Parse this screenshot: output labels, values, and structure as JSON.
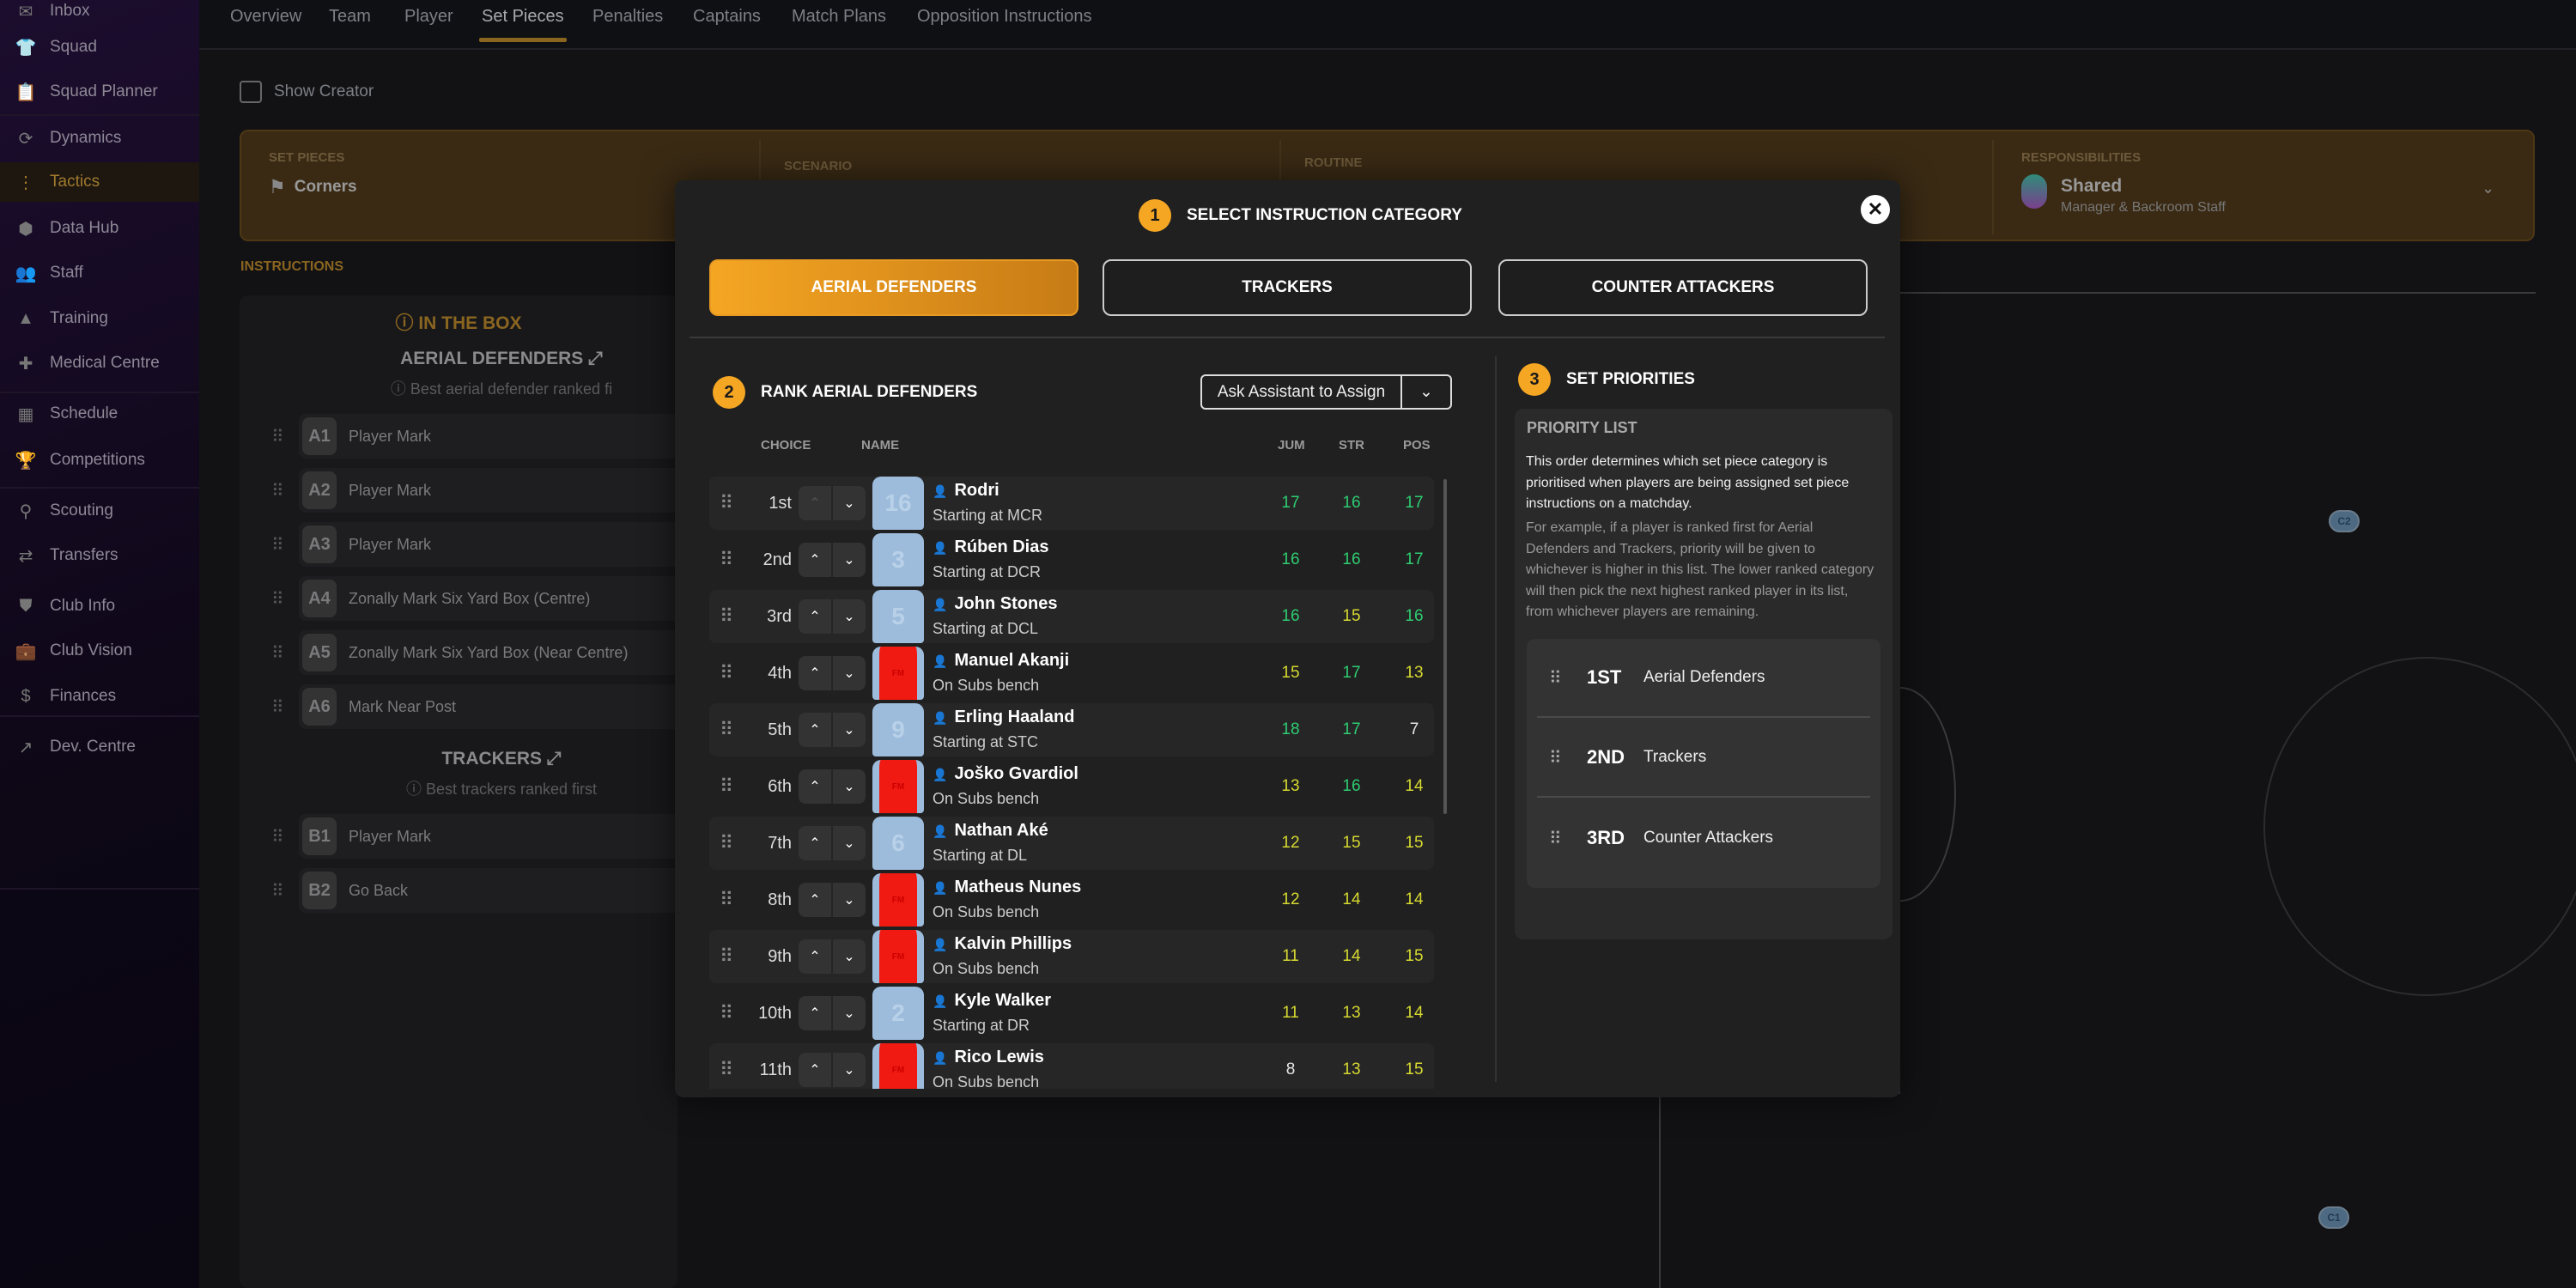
{
  "sidebar": {
    "items": [
      {
        "label": "Inbox",
        "icon": "inbox-icon",
        "glyph": "✉"
      },
      {
        "label": "Squad",
        "icon": "shirt-icon",
        "glyph": "👕"
      },
      {
        "label": "Squad Planner",
        "icon": "clipboard-icon",
        "glyph": "📋"
      },
      {
        "label": "Dynamics",
        "icon": "dynamics-icon",
        "glyph": "⟳"
      },
      {
        "label": "Tactics",
        "icon": "tactics-icon",
        "glyph": "⋮",
        "active": true
      },
      {
        "label": "Data Hub",
        "icon": "data-hub-icon",
        "glyph": "⬢"
      },
      {
        "label": "Staff",
        "icon": "staff-icon",
        "glyph": "👥"
      },
      {
        "label": "Training",
        "icon": "training-cone-icon",
        "glyph": "▲"
      },
      {
        "label": "Medical Centre",
        "icon": "medical-kit-icon",
        "glyph": "✚"
      },
      {
        "label": "Schedule",
        "icon": "calendar-icon",
        "glyph": "▦"
      },
      {
        "label": "Competitions",
        "icon": "trophy-icon",
        "glyph": "🏆"
      },
      {
        "label": "Scouting",
        "icon": "search-icon",
        "glyph": "⚲"
      },
      {
        "label": "Transfers",
        "icon": "transfers-icon",
        "glyph": "⇄"
      },
      {
        "label": "Club Info",
        "icon": "shield-icon",
        "glyph": "⛊"
      },
      {
        "label": "Club Vision",
        "icon": "briefcase-icon",
        "glyph": "💼"
      },
      {
        "label": "Finances",
        "icon": "money-icon",
        "glyph": "$"
      },
      {
        "label": "Dev. Centre",
        "icon": "growth-icon",
        "glyph": "↗"
      }
    ]
  },
  "tabs": [
    "Overview",
    "Team",
    "Player",
    "Set Pieces",
    "Penalties",
    "Captains",
    "Match Plans",
    "Opposition Instructions"
  ],
  "active_tab": "Set Pieces",
  "show_creator": {
    "label": "Show Creator",
    "checked": false
  },
  "set_pieces_band": {
    "set_pieces_label": "SET PIECES",
    "set_pieces_value": "Corners",
    "scenario_label": "SCENARIO",
    "routine_label": "ROUTINE",
    "responsibilities_label": "RESPONSIBILITIES",
    "responsibilities_value": "Shared",
    "responsibilities_sub": "Manager & Backroom Staff"
  },
  "instructions": {
    "label": "INSTRUCTIONS",
    "section": "IN THE BOX",
    "groups": [
      {
        "title": "AERIAL DEFENDERS",
        "hint": "Best aerial defender ranked fi",
        "items": [
          {
            "code": "A1",
            "text": "Player Mark"
          },
          {
            "code": "A2",
            "text": "Player Mark"
          },
          {
            "code": "A3",
            "text": "Player Mark"
          },
          {
            "code": "A4",
            "text": "Zonally Mark Six Yard Box (Centre)"
          },
          {
            "code": "A5",
            "text": "Zonally Mark Six Yard Box (Near Centre)"
          },
          {
            "code": "A6",
            "text": "Mark Near Post"
          }
        ]
      },
      {
        "title": "TRACKERS",
        "hint": "Best trackers ranked first",
        "items": [
          {
            "code": "B1",
            "text": "Player Mark"
          },
          {
            "code": "B2",
            "text": "Go Back"
          }
        ]
      }
    ]
  },
  "pitch": {
    "markers": [
      "C2",
      "C1"
    ]
  },
  "modal": {
    "step1": {
      "num": "1",
      "title": "SELECT INSTRUCTION CATEGORY"
    },
    "categories": [
      "AERIAL DEFENDERS",
      "TRACKERS",
      "COUNTER ATTACKERS"
    ],
    "active_category": "AERIAL DEFENDERS",
    "step2": {
      "num": "2",
      "title": "RANK AERIAL DEFENDERS"
    },
    "ask_assistant": "Ask Assistant to Assign",
    "columns": {
      "choice": "CHOICE",
      "name": "NAME",
      "jum": "JUM",
      "str": "STR",
      "pos": "POS"
    },
    "players": [
      {
        "rank": "1st",
        "name": "Rodri",
        "status": "Starting at MCR",
        "shirt": "16",
        "kit": "blue",
        "jum": 17,
        "str": 16,
        "pos": 17
      },
      {
        "rank": "2nd",
        "name": "Rúben Dias",
        "status": "Starting at DCR",
        "shirt": "3",
        "kit": "blue",
        "jum": 16,
        "str": 16,
        "pos": 17
      },
      {
        "rank": "3rd",
        "name": "John Stones",
        "status": "Starting at DCL",
        "shirt": "5",
        "kit": "blue",
        "jum": 16,
        "str": 15,
        "pos": 16
      },
      {
        "rank": "4th",
        "name": "Manuel Akanji",
        "status": "On Subs bench",
        "shirt": "FM",
        "kit": "red",
        "jum": 15,
        "str": 17,
        "pos": 13
      },
      {
        "rank": "5th",
        "name": "Erling Haaland",
        "status": "Starting at STC",
        "shirt": "9",
        "kit": "blue",
        "jum": 18,
        "str": 17,
        "pos": 7
      },
      {
        "rank": "6th",
        "name": "Joško Gvardiol",
        "status": "On Subs bench",
        "shirt": "FM",
        "kit": "red",
        "jum": 13,
        "str": 16,
        "pos": 14
      },
      {
        "rank": "7th",
        "name": "Nathan Aké",
        "status": "Starting at DL",
        "shirt": "6",
        "kit": "blue",
        "jum": 12,
        "str": 15,
        "pos": 15
      },
      {
        "rank": "8th",
        "name": "Matheus Nunes",
        "status": "On Subs bench",
        "shirt": "FM",
        "kit": "red",
        "jum": 12,
        "str": 14,
        "pos": 14
      },
      {
        "rank": "9th",
        "name": "Kalvin Phillips",
        "status": "On Subs bench",
        "shirt": "FM",
        "kit": "red",
        "jum": 11,
        "str": 14,
        "pos": 15
      },
      {
        "rank": "10th",
        "name": "Kyle Walker",
        "status": "Starting at DR",
        "shirt": "2",
        "kit": "blue",
        "jum": 11,
        "str": 13,
        "pos": 14
      },
      {
        "rank": "11th",
        "name": "Rico Lewis",
        "status": "On Subs bench",
        "shirt": "FM",
        "kit": "red",
        "jum": 8,
        "str": 13,
        "pos": 15
      }
    ],
    "step3": {
      "num": "3",
      "title": "SET PRIORITIES"
    },
    "priority": {
      "title": "PRIORITY LIST",
      "p1": "This order determines which set piece category is prioritised when players are being assigned set piece instructions on a matchday.",
      "p2": "For example, if a player is ranked first for Aerial Defenders and Trackers, priority will be given to whichever is higher in this list. The lower ranked category will then pick the next highest ranked player in its list, from whichever players are remaining.",
      "items": [
        {
          "order": "1ST",
          "category": "Aerial Defenders"
        },
        {
          "order": "2ND",
          "category": "Trackers"
        },
        {
          "order": "3RD",
          "category": "Counter Attackers"
        }
      ]
    }
  },
  "colors": {
    "accent": "#f5a623",
    "attr_high": "#2ecc71",
    "attr_mid": "#d6d930",
    "attr_low": "#e6e6e6"
  }
}
